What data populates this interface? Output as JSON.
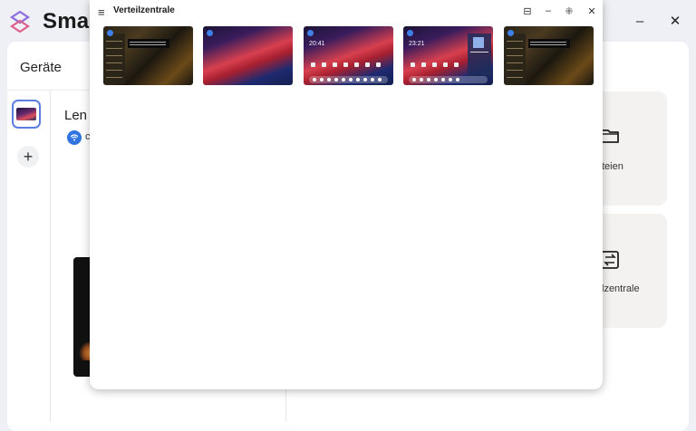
{
  "app": {
    "title": "Smar",
    "minimize_label": "–",
    "close_label": "✕"
  },
  "sidebar": {
    "heading": "Geräte",
    "add_label": "+"
  },
  "device": {
    "name": "Len",
    "status_fragment": "c"
  },
  "cards": {
    "files_label": "teien",
    "distribution_label": "lzentrale"
  },
  "window": {
    "title": "Verteilzentrale",
    "menu_icon": "≡",
    "pin_icon": "⊟",
    "minimize_label": "–",
    "compact_icon": "⁜",
    "close_label": "✕"
  },
  "thumbnails": {
    "clock_3": "20:41",
    "clock_4": "23:21"
  },
  "colors": {
    "accent": "#3f7fe8",
    "selected_border": "#5b7fe0",
    "card_bg": "#f3f2f1"
  }
}
